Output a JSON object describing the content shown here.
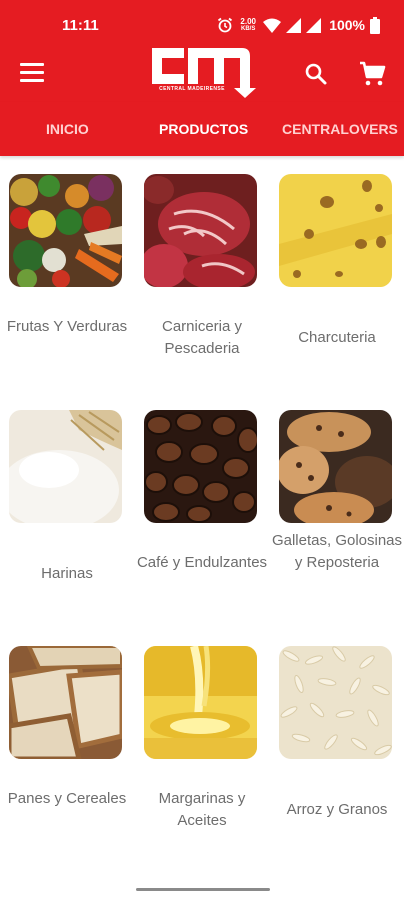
{
  "status": {
    "time": "11:11",
    "net_speed_value": "2.00",
    "net_speed_unit": "KB/S",
    "battery": "100%"
  },
  "app": {
    "logo_text": "cm",
    "logo_subtext": "CENTRAL MADEIRENSE"
  },
  "tabs": [
    {
      "label": "INICIO",
      "active": false
    },
    {
      "label": "PRODUCTOS",
      "active": true
    },
    {
      "label": "CENTRALOVERS",
      "active": false
    }
  ],
  "categories": [
    {
      "label": "Frutas Y Verduras",
      "image": "vegetables-photo"
    },
    {
      "label": "Carniceria y Pescaderia",
      "image": "meat-photo"
    },
    {
      "label": "Charcuteria",
      "image": "cheese-photo"
    },
    {
      "label": "Harinas",
      "image": "flour-photo"
    },
    {
      "label": "Café y Endulzantes",
      "image": "coffee-beans-photo"
    },
    {
      "label": "Galletas, Golosinas y Reposteria",
      "image": "cookies-photo"
    },
    {
      "label": "Panes y Cereales",
      "image": "bread-photo"
    },
    {
      "label": "Margarinas y Aceites",
      "image": "oil-photo"
    },
    {
      "label": "Arroz y Granos",
      "image": "rice-photo"
    }
  ],
  "colors": {
    "brand": "#e51c22",
    "label_text": "#6d6d6d"
  }
}
